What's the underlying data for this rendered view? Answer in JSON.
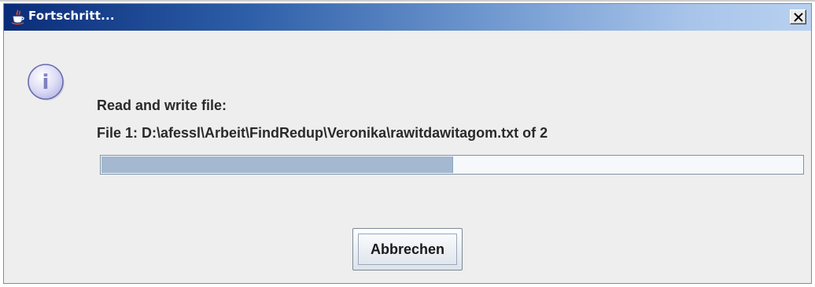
{
  "window": {
    "title": "Fortschritt...",
    "title_icon": "java-coffee-cup-icon",
    "close_icon": "close-icon"
  },
  "dialog": {
    "icon": "info-icon",
    "info_glyph": "i",
    "message_line1": "Read and write file:",
    "message_line2": "File 1: D:\\afessl\\Arbeit\\FindRedup\\Veronika\\rawitdawitagom.txt of 2",
    "progress_fraction": 0.5,
    "cancel_label": "Abbrechen"
  },
  "colors": {
    "title_gradient_start": "#0a2c78",
    "title_gradient_end": "#b8d1f0",
    "dialog_background": "#eeeeee",
    "progress_fill": "#a4b8cf"
  }
}
